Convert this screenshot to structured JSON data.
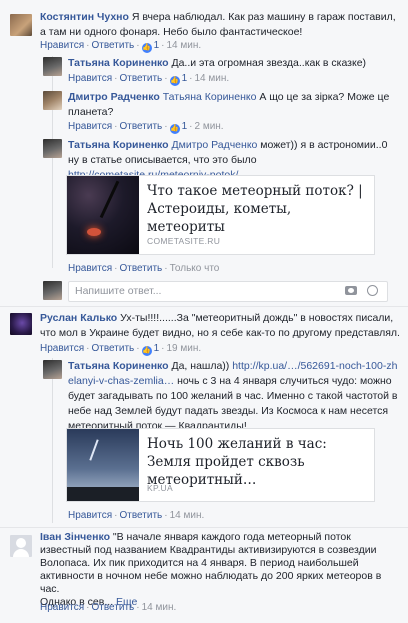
{
  "c1": {
    "author": "Костянтин Чухно",
    "text": "Я вчера наблюдал. Как раз машину в гараж поставил, а там ни одного фонаря. Небо было фантастическое!",
    "actions": {
      "like": "Нравится",
      "reply": "Ответить",
      "likes": "1",
      "time": "14 мин."
    }
  },
  "r1": {
    "author": "Татьяна Кориненко",
    "text": "Да..и эта огромная звезда..как в сказке)",
    "actions": {
      "like": "Нравится",
      "reply": "Ответить",
      "likes": "1",
      "time": "14 мин."
    }
  },
  "r2": {
    "author": "Дмитро Радченко",
    "mention": "Татьяна Кориненко",
    "text": "А що це за зірка? Може це планета?",
    "actions": {
      "like": "Нравится",
      "reply": "Ответить",
      "likes": "1",
      "time": "2 мин."
    }
  },
  "r3": {
    "author": "Татьяна Кориненко",
    "mention": "Дмитро Радченко",
    "text": "может)) я в астрономии..0 ну в статье описывается, что это было",
    "url": "http://cometasite.ru/meteorniy-potok/",
    "card": {
      "title": "Что такое метеорный поток? | Астероиды, кометы, метеориты",
      "source": "COMETASITE.RU"
    },
    "actions": {
      "like": "Нравится",
      "reply": "Ответить",
      "time": "Только что"
    }
  },
  "reply_input": {
    "placeholder": "Напишите ответ..."
  },
  "c2": {
    "author": "Руслан Калько",
    "text": "Ух-ты!!!!......За \"метеоритный дождь\" в новостях писали, что мол в Украине будет видно, но я себе как-то по другому представлял.",
    "actions": {
      "like": "Нравится",
      "reply": "Ответить",
      "likes": "1",
      "time": "19 мин."
    }
  },
  "r4": {
    "author": "Татьяна Кориненко",
    "pre": "Да, нашла))",
    "url": "http://kp.ua/…/562691-noch-100-zhelanyi-v-chas-zemlia…",
    "text": "ночь с 3 на 4 января случиться чудо: можно будет загадывать по 100 желаний в час. Именно с такой частотой в небе над Землей будут падать звезды. Из Космоса к нам несется метеоритный поток — Квадрантиды!",
    "card": {
      "title": "Ночь 100 желаний в час: Земля пройдет сквозь метеоритный…",
      "source": "KP.UA"
    },
    "actions": {
      "like": "Нравится",
      "reply": "Ответить",
      "time": "14 мин."
    }
  },
  "c3": {
    "author": "Іван Зінченко",
    "text": "\"В начале января каждого года метеорный поток известный под названием Квадрантиды активизируются в созвездии Волопаса. Их пик приходится на 4 января. В период наибольшей активности в ночном небе можно наблюдать до 200 ярких метеоров в час.",
    "tail": "Однако в сев...",
    "more": "Еще",
    "actions": {
      "like": "Нравится",
      "reply": "Ответить",
      "time": "14 мин."
    }
  }
}
